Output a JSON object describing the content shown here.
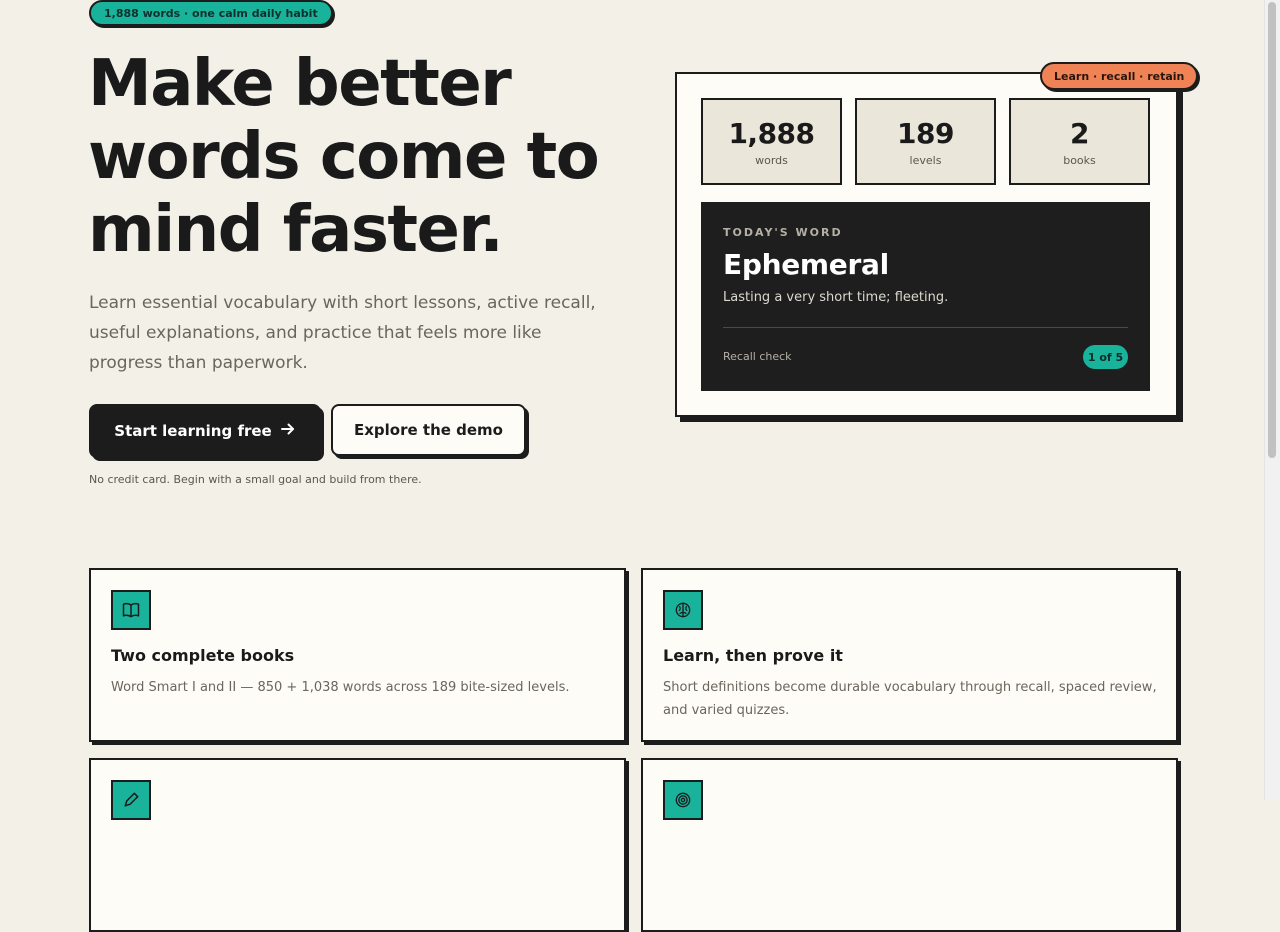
{
  "hero": {
    "badge": "1,888 words · one calm daily habit",
    "title": "Make better words come to mind faster.",
    "subtitle": "Learn essential vocabulary with short lessons, active recall, useful explanations, and practice that feels more like progress than paperwork.",
    "primary_cta": "Start learning free",
    "secondary_cta": "Explore the demo",
    "fineprint": "No credit card. Begin with a small goal and build from there."
  },
  "card": {
    "tag": "Learn · recall · retain",
    "stats": [
      {
        "value": "1,888",
        "label": "words"
      },
      {
        "value": "189",
        "label": "levels"
      },
      {
        "value": "2",
        "label": "books"
      }
    ],
    "word_of_day": {
      "kicker": "TODAY'S WORD",
      "word": "Ephemeral",
      "definition": "Lasting a very short time; fleeting.",
      "recall_label": "Recall check",
      "progress": "1 of 5"
    }
  },
  "features": [
    {
      "icon": "book-icon",
      "title": "Two complete books",
      "desc": "Word Smart I and II — 850 + 1,038 words across 189 bite-sized levels."
    },
    {
      "icon": "brain-icon",
      "title": "Learn, then prove it",
      "desc": "Short definitions become durable vocabulary through recall, spaced review, and varied quizzes."
    },
    {
      "icon": "pen-icon",
      "title": "",
      "desc": ""
    },
    {
      "icon": "target-icon",
      "title": "",
      "desc": ""
    }
  ],
  "colors": {
    "background": "#f3f0e8",
    "ink": "#1c1c1c",
    "teal": "#19b39b",
    "orange": "#ef8355",
    "card": "#fdfcf7",
    "stat_bg": "#ebe6da"
  }
}
